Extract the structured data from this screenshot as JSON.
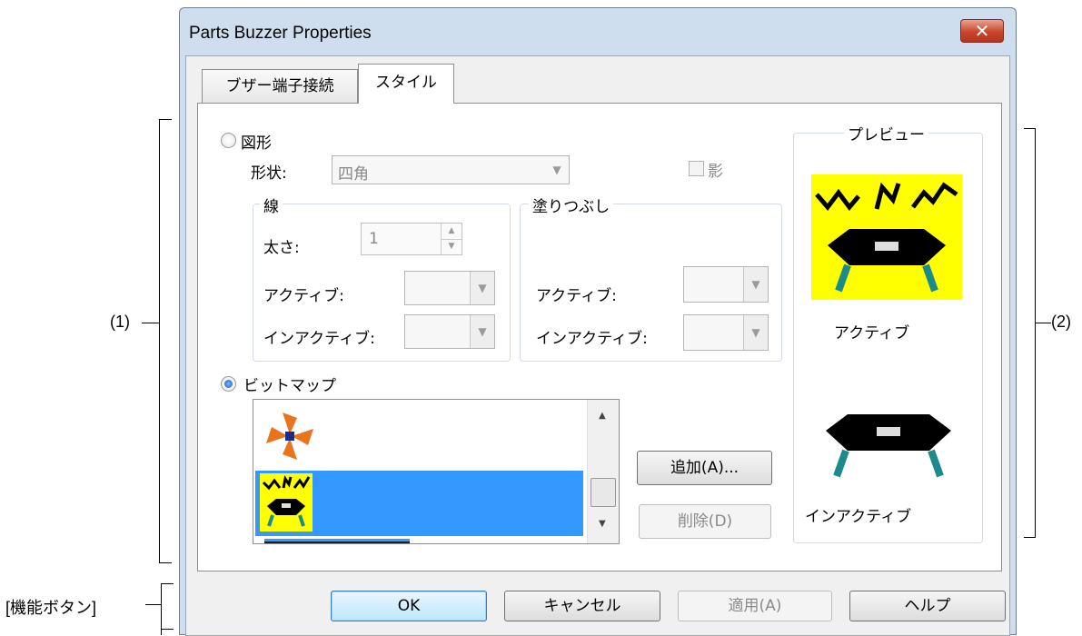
{
  "window": {
    "title": "Parts Buzzer Properties",
    "close_symbol": "✕"
  },
  "tabs": [
    {
      "label": "ブザー端子接続",
      "active": false
    },
    {
      "label": "スタイル",
      "active": true
    }
  ],
  "shape": {
    "radio_label": "図形",
    "form_label": "形状:",
    "form_value": "四角",
    "shadow_label": "影",
    "line": {
      "group_label": "線",
      "thickness_label": "太さ:",
      "thickness_value": "1",
      "active_label": "アクティブ:",
      "inactive_label": "インアクティブ:"
    },
    "fill": {
      "group_label": "塗りつぶし",
      "active_label": "アクティブ:",
      "inactive_label": "インアクティブ:"
    }
  },
  "bitmap": {
    "radio_label": "ビットマップ",
    "add_button": "追加(A)...",
    "delete_button": "削除(D)",
    "items": [
      "fan-bitmap",
      "buzzer-active-bitmap",
      "buzzer-inactive-bitmap"
    ],
    "selected_index": 1
  },
  "preview": {
    "group_label": "プレビュー",
    "active_label": "アクティブ",
    "inactive_label": "インアクティブ"
  },
  "buttons": {
    "ok": "OK",
    "cancel": "キャンセル",
    "apply": "適用(A)",
    "help": "ヘルプ"
  },
  "annotations": {
    "section1": "(1)",
    "section2": "(2)",
    "function_buttons": "[機能ボタン]"
  },
  "colors": {
    "selection": "#3399ff",
    "bitmap_bg": "#ffff00",
    "buzzer_body": "#000000",
    "buzzer_legs": "#1a8a8a"
  }
}
